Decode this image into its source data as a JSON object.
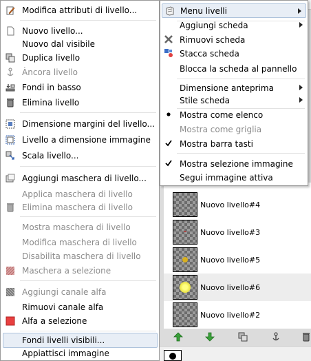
{
  "layers_panel": {
    "rows": [
      {
        "name": "Nuovo livello#4"
      },
      {
        "name": "Nuovo livello#3"
      },
      {
        "name": "Nuovo livello#5"
      },
      {
        "name": "Nuovo livello#6"
      },
      {
        "name": "Nuovo livello#2"
      }
    ]
  },
  "context_menu": {
    "items": [
      {
        "label": "Modifica attributi di livello...",
        "icon": "edit-icon"
      },
      {
        "label": "Nuovo livello...",
        "icon": "new-document-icon"
      },
      {
        "label": "Nuovo dal visibile",
        "icon": ""
      },
      {
        "label": "Duplica livello",
        "icon": "duplicate-icon"
      },
      {
        "label": "Àncora livello",
        "icon": "anchor-icon"
      },
      {
        "label": "Fondi in basso",
        "icon": "merge-down-icon"
      },
      {
        "label": "Elimina livello",
        "icon": "trash-icon"
      },
      {
        "label": "Dimensione margini del livello...",
        "icon": "layer-boundary-icon"
      },
      {
        "label": "Livello a dimensione immagine",
        "icon": "layer-to-image-icon"
      },
      {
        "label": "Scala livello...",
        "icon": "scale-icon"
      },
      {
        "label": "Aggiungi maschera di livello...",
        "icon": "add-mask-icon"
      },
      {
        "label": "Applica maschera di livello",
        "icon": ""
      },
      {
        "label": "Elimina maschera di livello",
        "icon": "trash-icon"
      },
      {
        "label": "Mostra maschera di livello",
        "icon": ""
      },
      {
        "label": "Modifica maschera di livello",
        "icon": ""
      },
      {
        "label": "Disabilita maschera di livello",
        "icon": ""
      },
      {
        "label": "Maschera a selezione",
        "icon": "mask-to-selection-icon"
      },
      {
        "label": "Aggiungi canale alfa",
        "icon": "alpha-channel-icon"
      },
      {
        "label": "Rimuovi canale alfa",
        "icon": ""
      },
      {
        "label": "Alfa a selezione",
        "icon": "alpha-to-selection-icon"
      },
      {
        "label": "Fondi livelli visibili...",
        "icon": ""
      },
      {
        "label": "Appiattisci immagine",
        "icon": ""
      }
    ]
  },
  "submenu": {
    "items": [
      {
        "label": "Menu livelli",
        "icon": "menu-icon"
      },
      {
        "label": "Aggiungi scheda",
        "icon": ""
      },
      {
        "label": "Rimuovi scheda",
        "icon": "close-x-icon"
      },
      {
        "label": "Stacca scheda",
        "icon": "detach-icon"
      },
      {
        "label": "Blocca la scheda al pannello",
        "icon": ""
      },
      {
        "label": "Dimensione anteprima",
        "icon": ""
      },
      {
        "label": "Stile scheda",
        "icon": ""
      },
      {
        "label": "Mostra come elenco",
        "icon": "radio-dot-icon"
      },
      {
        "label": "Mostra come griglia",
        "icon": ""
      },
      {
        "label": "Mostra barra tasti",
        "icon": "check-icon"
      },
      {
        "label": "Mostra selezione immagine",
        "icon": "check-icon"
      },
      {
        "label": "Segui immagine attiva",
        "icon": ""
      }
    ]
  },
  "colors": {
    "highlight_bg": "#e8eef6",
    "highlight_border": "#aec3dc",
    "disabled_text": "#8c8c8c",
    "green_arrow": "#3aa03a"
  }
}
